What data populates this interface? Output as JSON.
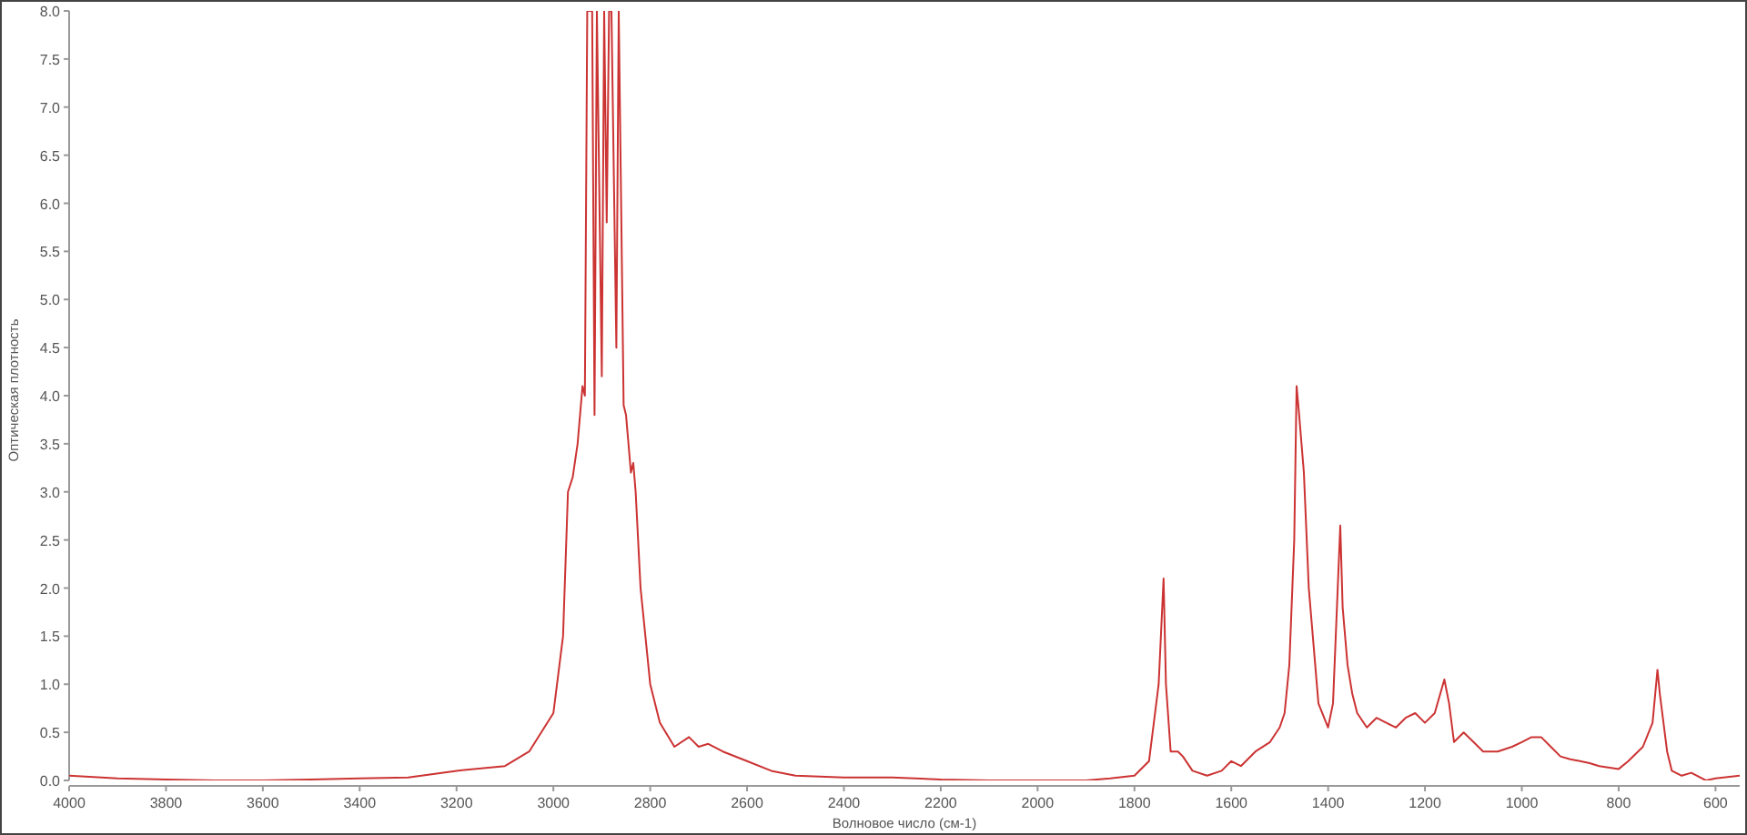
{
  "chart_data": {
    "type": "line",
    "xlabel": "Волновое число (см-1)",
    "ylabel": "Оптическая плотность",
    "xlim": [
      4000,
      550
    ],
    "ylim": [
      0,
      8
    ],
    "xticks": [
      4000,
      3800,
      3600,
      3400,
      3200,
      3000,
      2800,
      2600,
      2400,
      2200,
      2000,
      1800,
      1600,
      1400,
      1200,
      1000,
      800,
      600
    ],
    "yticks": [
      {
        "value": 0,
        "label": "0.0"
      },
      {
        "value": 0.5,
        "label": "0.5"
      },
      {
        "value": 1,
        "label": "1.0"
      },
      {
        "value": 1.5,
        "label": "1.5"
      },
      {
        "value": 2,
        "label": "2.0"
      },
      {
        "value": 2.5,
        "label": "2.5"
      },
      {
        "value": 3,
        "label": "3.0"
      },
      {
        "value": 3.5,
        "label": "3.5"
      },
      {
        "value": 4,
        "label": "4.0"
      },
      {
        "value": 4.5,
        "label": "4.5"
      },
      {
        "value": 5,
        "label": "5.0"
      },
      {
        "value": 5.5,
        "label": "5.5"
      },
      {
        "value": 6,
        "label": "6.0"
      },
      {
        "value": 6.5,
        "label": "6.5"
      },
      {
        "value": 7,
        "label": "7.0"
      },
      {
        "value": 7.5,
        "label": "7.5"
      },
      {
        "value": 8,
        "label": "8.0"
      }
    ],
    "x": [
      4000,
      3900,
      3800,
      3700,
      3600,
      3500,
      3400,
      3300,
      3200,
      3100,
      3050,
      3000,
      2980,
      2970,
      2960,
      2950,
      2940,
      2935,
      2930,
      2920,
      2915,
      2910,
      2900,
      2895,
      2890,
      2885,
      2880,
      2870,
      2865,
      2855,
      2850,
      2840,
      2835,
      2830,
      2820,
      2800,
      2780,
      2750,
      2720,
      2700,
      2680,
      2650,
      2600,
      2550,
      2500,
      2400,
      2300,
      2200,
      2100,
      2000,
      1900,
      1850,
      1800,
      1770,
      1750,
      1740,
      1735,
      1725,
      1710,
      1700,
      1680,
      1650,
      1620,
      1600,
      1580,
      1550,
      1520,
      1500,
      1490,
      1480,
      1470,
      1465,
      1460,
      1455,
      1450,
      1440,
      1420,
      1400,
      1390,
      1380,
      1375,
      1370,
      1360,
      1350,
      1340,
      1320,
      1300,
      1280,
      1260,
      1240,
      1220,
      1200,
      1180,
      1160,
      1150,
      1140,
      1120,
      1100,
      1080,
      1050,
      1020,
      1000,
      980,
      960,
      940,
      920,
      900,
      880,
      860,
      840,
      800,
      780,
      750,
      730,
      720,
      715,
      700,
      690,
      670,
      650,
      620,
      600,
      550
    ],
    "series": [
      {
        "color": "#cc3333",
        "values": [
          0.05,
          0.02,
          0.01,
          0.0,
          0.0,
          0.01,
          0.02,
          0.03,
          0.1,
          0.15,
          0.3,
          0.7,
          1.5,
          3.0,
          3.15,
          3.5,
          4.1,
          4.0,
          8.0,
          8.0,
          3.8,
          8.0,
          4.2,
          8.0,
          5.8,
          8.0,
          8.0,
          4.5,
          8.0,
          3.9,
          3.8,
          3.2,
          3.3,
          3.0,
          2.0,
          1.0,
          0.6,
          0.35,
          0.45,
          0.35,
          0.38,
          0.3,
          0.2,
          0.1,
          0.05,
          0.03,
          0.03,
          0.01,
          0.0,
          0.0,
          0.0,
          0.02,
          0.05,
          0.2,
          1.0,
          2.1,
          1.0,
          0.3,
          0.3,
          0.25,
          0.1,
          0.05,
          0.1,
          0.2,
          0.15,
          0.3,
          0.4,
          0.55,
          0.7,
          1.2,
          2.5,
          4.1,
          3.8,
          3.5,
          3.2,
          2.0,
          0.8,
          0.55,
          0.8,
          2.0,
          2.65,
          1.8,
          1.2,
          0.9,
          0.7,
          0.55,
          0.65,
          0.6,
          0.55,
          0.65,
          0.7,
          0.6,
          0.7,
          1.05,
          0.8,
          0.4,
          0.5,
          0.4,
          0.3,
          0.3,
          0.35,
          0.4,
          0.45,
          0.45,
          0.35,
          0.25,
          0.22,
          0.2,
          0.18,
          0.15,
          0.12,
          0.2,
          0.35,
          0.6,
          1.15,
          0.9,
          0.3,
          0.1,
          0.05,
          0.08,
          0.0,
          0.02,
          0.05
        ]
      }
    ]
  }
}
